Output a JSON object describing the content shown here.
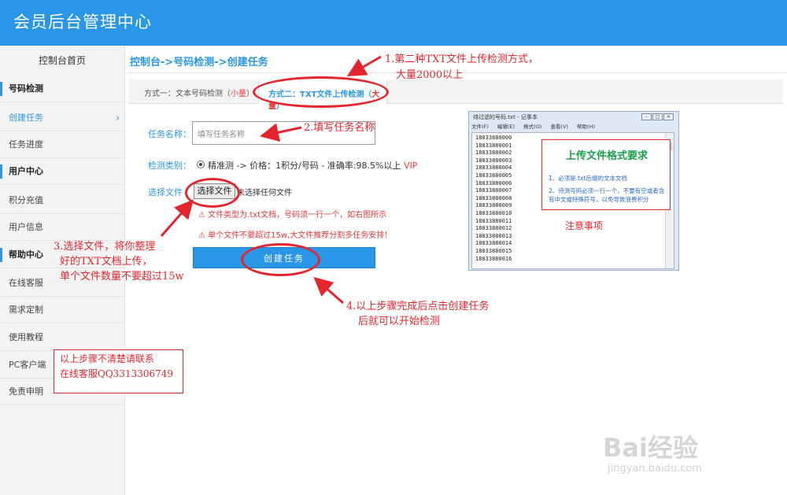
{
  "header": {
    "title": "会员后台管理中心"
  },
  "sidebar": {
    "home": "控制台首页",
    "items": [
      {
        "label": "号码检测",
        "type": "section"
      },
      {
        "label": "创建任务",
        "type": "active"
      },
      {
        "label": "任务进度",
        "type": "item"
      },
      {
        "label": "用户中心",
        "type": "section"
      },
      {
        "label": "积分充值",
        "type": "item"
      },
      {
        "label": "用户信息",
        "type": "item"
      },
      {
        "label": "帮助中心",
        "type": "section"
      },
      {
        "label": "在线客服",
        "type": "item"
      },
      {
        "label": "需求定制",
        "type": "item"
      },
      {
        "label": "使用教程",
        "type": "item"
      },
      {
        "label": "PC客户端",
        "type": "item"
      },
      {
        "label": "免责申明",
        "type": "item"
      }
    ]
  },
  "breadcrumb": "控制台->号码检测->创建任务",
  "tabs": {
    "tab1_text": "方式一：文本号码检测（",
    "tab1_hl": "小量",
    "tab1_end": "）",
    "tab2_text": "方式二：TXT文件上传检测（",
    "tab2_hl": "大量",
    "tab2_end": "）"
  },
  "form": {
    "task_name_label": "任务名称：",
    "task_name_placeholder": "填写任务名称",
    "detect_type_label": "检测类别：",
    "detect_option": "精准测 -> 价格：1积分/号码 - 准确率:98.5%以上 ",
    "detect_vip": "VIP",
    "file_label": "选择文件",
    "file_button": "选择文件",
    "file_status": "未选择任何文件",
    "warning1": "⚠ 文件类型为.txt文档，号码须一行一个，如右图所示",
    "warning2": "⚠ 单个文件不要超过15w,大文件推荐分割多任务安排！",
    "submit": "创建任务"
  },
  "notepad": {
    "title": "待过滤的号码.txt - 记事本",
    "menu": [
      "文件(F)",
      "编辑(E)",
      "格式(O)",
      "查看(V)",
      "帮助(H)"
    ],
    "lines": [
      "18833880000",
      "18833880001",
      "18833880002",
      "18833880003",
      "18833880004",
      "18833880005",
      "18833880006",
      "18833880007",
      "18833880008",
      "18833880009",
      "18833880010",
      "18833880011",
      "18833880012",
      "18833880013",
      "18833880014",
      "18833880015",
      "18833880016"
    ],
    "req_title": "上传文件格式要求",
    "req1": "1、必须是.txt后缀的文本文档",
    "req2": "2、待测号码必须一行一个，不要有空或者含有中文或特殊符号，以免导致浪费积分"
  },
  "annotations": {
    "a1_line1": "1.第二种TXT文件上传检测方式，",
    "a1_line2": "大量2000以上",
    "a2": "2.填写任务名称",
    "a3_line1": "3.选择文件，将你整理",
    "a3_line2": "好的TXT文档上传，",
    "a3_line3": "单个文件数量不要超过15w",
    "a4_line1": "4.以上步骤完成后点击创建任务",
    "a4_line2": "后就可以开始检测",
    "note": "注意事项",
    "contact_line1": "以上步骤不清楚请联系",
    "contact_line2": "在线客服QQ3313306749"
  },
  "watermark": {
    "line1": "Bai经验",
    "line2": "jingyan.baidu.com"
  },
  "colors": {
    "brand": "#2a96e6",
    "annotation": "#e3262d",
    "green": "#1aa04a"
  }
}
